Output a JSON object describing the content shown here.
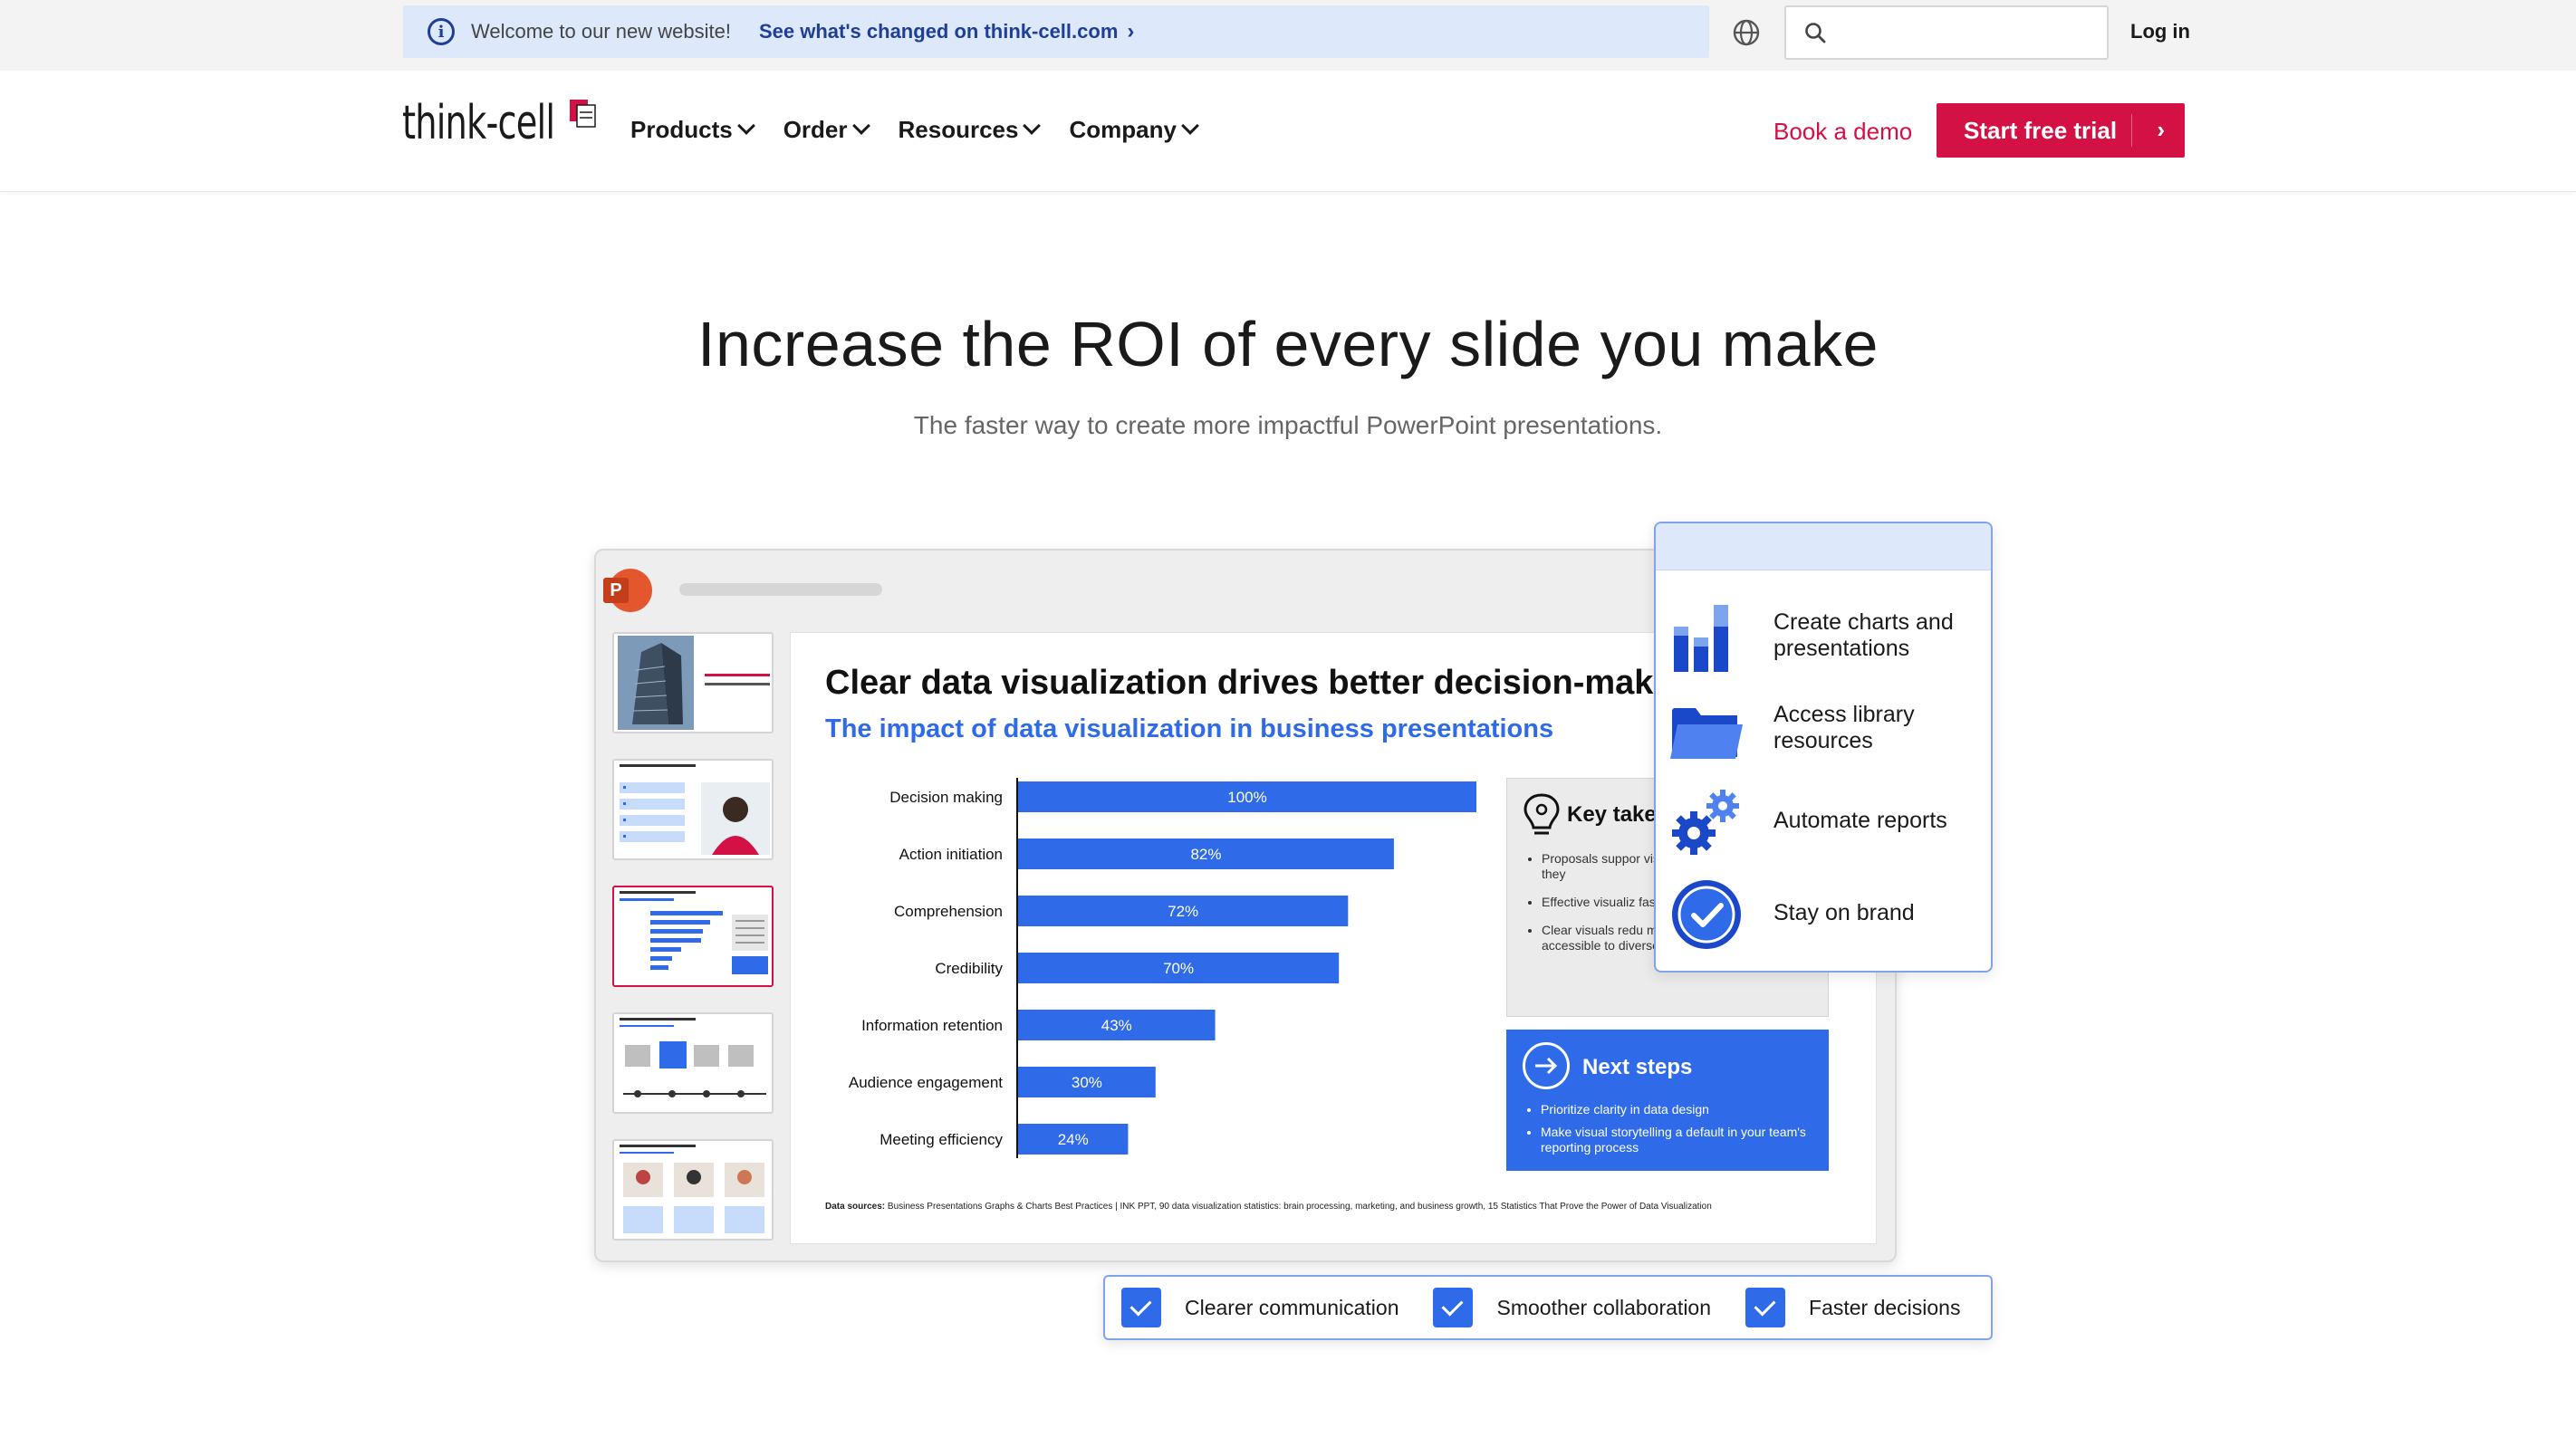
{
  "notice": {
    "welcome": "Welcome to our new website!",
    "changed_link": "See what's changed on think-cell.com"
  },
  "header": {
    "search_placeholder": "",
    "login": "Log in"
  },
  "nav": {
    "logo": "think-cell",
    "items": [
      "Products",
      "Order",
      "Resources",
      "Company"
    ],
    "demo": "Book a demo",
    "trial": "Start free trial"
  },
  "hero": {
    "title": "Increase the ROI of every slide you make",
    "subtitle": "The faster way to create more impactful PowerPoint presentations."
  },
  "slide": {
    "title": "Clear data visualization drives better decision-maki",
    "subtitle": "The impact of data visualization in business presentations",
    "sources_label": "Data sources:",
    "sources_text": " Business Presentations Graphs & Charts Best Practices | INK PPT, 90 data visualization statistics: brain processing, marketing, and business growth, 15 Statistics That Prove the Power of Data Visualization",
    "takeaways": {
      "title": "Key take",
      "items": [
        "Proposals suppor visuals are not or understand; they",
        "Effective visualiz faster decision cy",
        "Clear visuals redu making complex data accessible to diverse audiences"
      ]
    },
    "next_steps": {
      "title": "Next steps",
      "items": [
        "Prioritize clarity in data design",
        "Make visual storytelling a default in your team's reporting process"
      ]
    }
  },
  "chart_data": {
    "type": "bar",
    "orientation": "horizontal",
    "categories": [
      "Decision making",
      "Action initiation",
      "Comprehension",
      "Credibility",
      "Information retention",
      "Audience engagement",
      "Meeting efficiency"
    ],
    "values": [
      100,
      82,
      72,
      70,
      43,
      30,
      24
    ],
    "value_labels": [
      "100%",
      "82%",
      "72%",
      "70%",
      "43%",
      "30%",
      "24%"
    ],
    "xlim": [
      0,
      100
    ],
    "color": "#2f6be8"
  },
  "features": [
    {
      "label": "Create charts and presentations",
      "icon": "bar-chart-icon"
    },
    {
      "label": "Access library resources",
      "icon": "folder-icon"
    },
    {
      "label": "Automate reports",
      "icon": "gears-icon"
    },
    {
      "label": "Stay on brand",
      "icon": "badge-check-icon"
    }
  ],
  "checks": [
    "Clearer communication",
    "Smoother collaboration",
    "Faster decisions"
  ],
  "colors": {
    "brand_red": "#d31145",
    "accent_blue": "#2f6be8",
    "notice_bg": "#dde8fb",
    "link_blue": "#1f3f95"
  }
}
